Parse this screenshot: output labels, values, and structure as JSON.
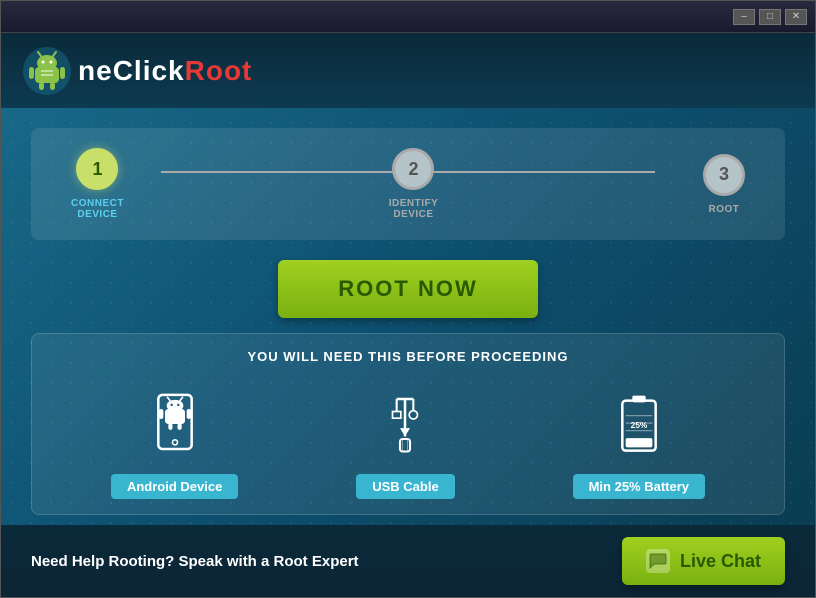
{
  "window": {
    "title": "OneClickRoot",
    "controls": {
      "minimize": "–",
      "maximize": "□",
      "close": "✕"
    }
  },
  "header": {
    "logo_text_one": "ne",
    "logo_text_click": "Click",
    "logo_text_root": "Root"
  },
  "steps": [
    {
      "number": "1",
      "label": "CONNECT\nDEVICE",
      "active": true
    },
    {
      "number": "2",
      "label": "IDENTIFY\nDEVICE",
      "active": false
    },
    {
      "number": "3",
      "label": "ROOT",
      "active": false
    }
  ],
  "root_button": {
    "label": "ROOT NOW"
  },
  "prereq": {
    "title": "YOU WILL NEED THIS BEFORE PROCEEDING",
    "items": [
      {
        "label": "Android Device",
        "icon": "android-icon"
      },
      {
        "label": "USB Cable",
        "icon": "usb-icon"
      },
      {
        "label": "Min 25% Battery",
        "icon": "battery-icon"
      }
    ]
  },
  "footer": {
    "help_text": "Need Help Rooting? Speak with a Root Expert",
    "live_chat_label": "Live Chat"
  },
  "colors": {
    "accent_green": "#a0d020",
    "accent_blue": "#3ab5d0",
    "background_dark": "#0a2a3a",
    "step_active": "#c8e06a"
  }
}
